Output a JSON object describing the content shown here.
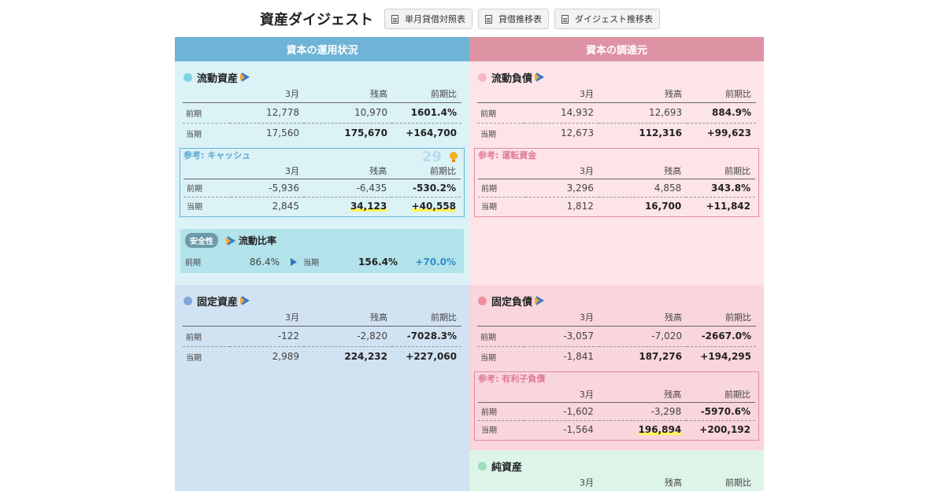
{
  "header": {
    "title": "資産ダイジェスト",
    "buttons": [
      "単月貸借対照表",
      "貸借推移表",
      "ダイジェスト推移表"
    ]
  },
  "columns": {
    "left": "資本の運用状況",
    "right": "資本の調達元"
  },
  "table_headers": [
    "",
    "3月",
    "残高",
    "前期比"
  ],
  "colors": {
    "left_header": "#6fb3d6",
    "right_header": "#de93a5",
    "cur_assets_dot": "#7fd3e3",
    "fix_assets_dot": "#7fa8d8",
    "cur_liab_dot": "#f7b6c3",
    "fix_liab_dot": "#ee8e9d",
    "net_dot": "#9fdcbb"
  },
  "current_assets": {
    "title": "流動資産",
    "rows": [
      {
        "label": "前期",
        "month": "12,778",
        "balance": "10,970",
        "ratio": "1601.4%"
      },
      {
        "label": "当期",
        "month": "17,560",
        "balance": "175,670",
        "ratio": "+164,700"
      }
    ],
    "ref": {
      "title": "参考: キャッシュ",
      "badge": "29",
      "rows": [
        {
          "label": "前期",
          "month": "-5,936",
          "balance": "-6,435",
          "ratio": "-530.2%"
        },
        {
          "label": "当期",
          "month": "2,845",
          "balance": "34,123",
          "ratio": "+40,558"
        }
      ]
    },
    "safety": {
      "pill": "安全性",
      "title": "流動比率",
      "prev_label": "前期",
      "prev_value": "86.4%",
      "cur_label": "当期",
      "cur_value": "156.4%",
      "diff": "+70.0%"
    }
  },
  "fixed_assets": {
    "title": "固定資産",
    "rows": [
      {
        "label": "前期",
        "month": "-122",
        "balance": "-2,820",
        "ratio": "-7028.3%"
      },
      {
        "label": "当期",
        "month": "2,989",
        "balance": "224,232",
        "ratio": "+227,060"
      }
    ]
  },
  "current_liabilities": {
    "title": "流動負債",
    "rows": [
      {
        "label": "前期",
        "month": "14,932",
        "balance": "12,693",
        "ratio": "884.9%"
      },
      {
        "label": "当期",
        "month": "12,673",
        "balance": "112,316",
        "ratio": "+99,623"
      }
    ],
    "ref": {
      "title": "参考: 運転資金",
      "rows": [
        {
          "label": "前期",
          "month": "3,296",
          "balance": "4,858",
          "ratio": "343.8%"
        },
        {
          "label": "当期",
          "month": "1,812",
          "balance": "16,700",
          "ratio": "+11,842"
        }
      ]
    }
  },
  "fixed_liabilities": {
    "title": "固定負債",
    "rows": [
      {
        "label": "前期",
        "month": "-3,057",
        "balance": "-7,020",
        "ratio": "-2667.0%"
      },
      {
        "label": "当期",
        "month": "-1,841",
        "balance": "187,276",
        "ratio": "+194,295"
      }
    ],
    "ref": {
      "title": "参考: 有利子負債",
      "rows": [
        {
          "label": "前期",
          "month": "-1,602",
          "balance": "-3,298",
          "ratio": "-5970.6%"
        },
        {
          "label": "当期",
          "month": "-1,564",
          "balance": "196,894",
          "ratio": "+200,192"
        }
      ]
    }
  },
  "net_assets": {
    "title": "純資産"
  }
}
